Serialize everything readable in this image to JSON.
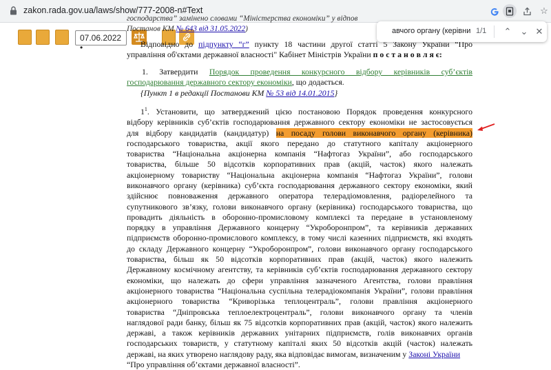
{
  "browser": {
    "url": "zakon.rada.gov.ua/laws/show/777-2008-n#Text",
    "icons": [
      "google-icon",
      "reader-icon",
      "share-icon",
      "bookmark-star-icon",
      "extension-icon"
    ]
  },
  "find": {
    "query": "авчого органу (керівника)",
    "count": "1/1"
  },
  "toolbar": {
    "date": "07.06.2022 •"
  },
  "doc": {
    "top1": "господарства” замінено словами “Міністерства економіки” у відпов",
    "top2a": "Постанов КМ ",
    "top2link": "№ 643 від 31.05.2022",
    "top2b": ")",
    "intro1a": "Відповідно до ",
    "intro1link": "підпункту “г”",
    "intro1b": " пункту 18 частини другої статті 5 Закону України “Про",
    "intro2a": "управління об'єктами державної власності\" Кабінет Міністрів України ",
    "intro2b": "п о с т а н о в л я є:",
    "item1prefix": "1.  Затвердити ",
    "item1link1": "Порядок  проведення  конкурсного  відбору  керівників  суб’єктів",
    "item1link2": "господарювання державного сектору економіки",
    "item1suffix": ", що додається.",
    "note1a": "{Пункт 1 в редакції Постанови КМ ",
    "note1link": "№ 53 від 14.01.2015",
    "note1b": "}",
    "p2num": "1",
    "p2sup": "1",
    "p2l1": ". Установити, що затверджений цією постановою Порядок проведення конкурсного",
    "p2l2": "відбору керівників суб’єктів господарювання державного сектору економіки не застосовується",
    "p2l3a": "для відбору кандидатів (кандидатур) ",
    "p2l3hl": "на посаду голови виконавчого органу (керівника)",
    "lines": [
      "господарського  товариства,  акції  якого  передано  до  статутного  капіталу  акціонерного",
      "товариства “Національна акціонерна компанія “Нафтогаз України”, або господарського",
      "товариства,  більше  50  відсотків  корпоративних  прав  (акцій,  часток)  якого  належать",
      "акціонерному товариству “Національна акціонерна компанія “Нафтогаз України”, голови",
      "виконавчого органу (керівника) суб’єкта господарювання державного сектору економіки, який",
      "здійснює  повноваження  державного  оператора  телерадіомовлення,  радіорелейного  та",
      "супутникового зв’язку, голови виконавчого органу (керівника) господарського товариства, що",
      "провадить діяльність в оборонно-промисловому комплексі та передане в установленому",
      "порядку в управління Державного концерну “Укроборонпром”, та керівників державних",
      "підприємств оборонно-промислового комплексу, в тому числі казенних підприємств, які входять",
      "до складу Державного концерну “Укроборонпром”, голови виконавчого органу господарського",
      "товариства,  більш  як  50  відсотків  корпоративних  прав  (акцій,  часток)  якого  належить",
      "Державному космічному агентству, та керівників суб’єктів господарювання державного сектору",
      "економіки,  що  належать  до  сфери  управління  зазначеного  Агентства,  голови  правління",
      "акціонерного товариства “Національна суспільна телерадіокомпанія України”, голови правління",
      "акціонерного  товариства  “Криворізька  теплоцентраль”,  голови  правління  акціонерного",
      "товариства  “Дніпровська  теплоелектроцентраль”,  голови  виконавчого  органу  та  членів",
      "наглядової ради банку, більш як 75 відсотків корпоративних прав (акцій, часток) якого належить",
      "державі,  а  також  керівників  державних  унітарних  підприємств,  голів  виконавчих  органів",
      "господарських  товариств,  у  статутному  капіталі  яких  50  відсотків  акцій  (часток)  належать"
    ],
    "lastA": "державі, на яких утворено наглядову раду, яка відповідає вимогам, визначеним у ",
    "lastLink": "Законі України",
    "final": "“Про управління об’єктами державної власності”."
  }
}
